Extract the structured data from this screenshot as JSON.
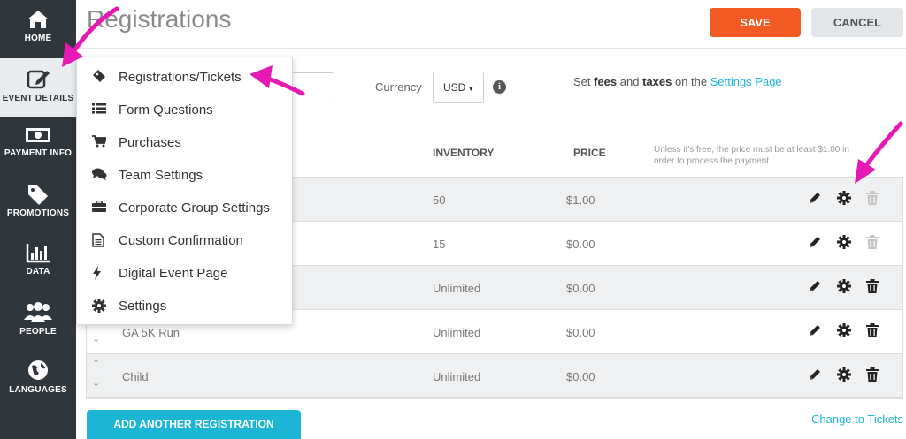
{
  "sidebar": {
    "items": [
      {
        "label": "HOME",
        "icon": "home-icon"
      },
      {
        "label": "EVENT DETAILS",
        "icon": "edit-icon",
        "active": true
      },
      {
        "label": "PAYMENT INFO",
        "icon": "money-icon"
      },
      {
        "label": "PROMOTIONS",
        "icon": "tag-icon"
      },
      {
        "label": "DATA",
        "icon": "bar-chart-icon"
      },
      {
        "label": "PEOPLE",
        "icon": "people-icon"
      },
      {
        "label": "LANGUAGES",
        "icon": "globe-icon"
      }
    ]
  },
  "header": {
    "title": "Registrations",
    "save_label": "SAVE",
    "cancel_label": "CANCEL"
  },
  "currency": {
    "label": "Currency",
    "selected": "USD"
  },
  "fees_note": {
    "prefix": "Set ",
    "fees": "fees",
    "and": " and ",
    "taxes": "taxes",
    "on_the": " on the ",
    "link": "Settings Page"
  },
  "table": {
    "headers": {
      "inventory": "INVENTORY",
      "price": "PRICE"
    },
    "price_note_line1": "Unless it's free, the price must be at least $1.00 in",
    "price_note_line2": "order to process the payment.",
    "rows": [
      {
        "name": "",
        "inventory": "50",
        "price": "$1.00",
        "delete_enabled": false
      },
      {
        "name": "",
        "inventory": "15",
        "price": "$0.00",
        "delete_enabled": false
      },
      {
        "name": "",
        "inventory": "Unlimited",
        "price": "$0.00",
        "delete_enabled": true
      },
      {
        "name": "GA 5K Run",
        "inventory": "Unlimited",
        "price": "$0.00",
        "delete_enabled": true
      },
      {
        "name": "Child",
        "inventory": "Unlimited",
        "price": "$0.00",
        "delete_enabled": true
      }
    ]
  },
  "dropdown": {
    "items": [
      {
        "label": "Registrations/Tickets",
        "icon": "ticket-icon"
      },
      {
        "label": "Form Questions",
        "icon": "list-icon"
      },
      {
        "label": "Purchases",
        "icon": "cart-icon"
      },
      {
        "label": "Team Settings",
        "icon": "comments-icon"
      },
      {
        "label": "Corporate Group Settings",
        "icon": "briefcase-icon"
      },
      {
        "label": "Custom Confirmation",
        "icon": "document-icon"
      },
      {
        "label": "Digital Event Page",
        "icon": "bolt-icon"
      },
      {
        "label": "Settings",
        "icon": "gear-icon"
      }
    ]
  },
  "footer": {
    "add_label": "ADD ANOTHER REGISTRATION",
    "change_link": "Change to Tickets"
  },
  "colors": {
    "sidebar": "#2f363c",
    "accent_orange": "#f15a22",
    "accent_cyan": "#1db5d6",
    "annotation_arrow": "#e619b4"
  }
}
